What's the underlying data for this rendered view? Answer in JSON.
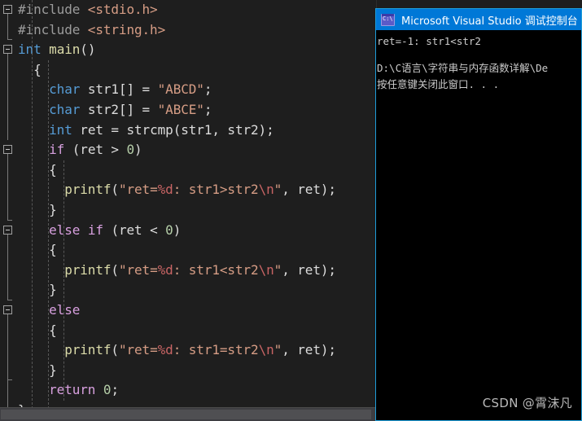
{
  "editor": {
    "name": "visual-studio-code-editor",
    "background_color": "#1e1e1e",
    "code_lines": [
      {
        "indent": 0,
        "fold": "minus",
        "tokens": [
          {
            "t": "#include ",
            "c": "c-pre"
          },
          {
            "t": "<stdio.h>",
            "c": "c-hdr"
          }
        ]
      },
      {
        "indent": 0,
        "fold": "bar-end",
        "tokens": [
          {
            "t": "#include ",
            "c": "c-pre"
          },
          {
            "t": "<string.h>",
            "c": "c-hdr"
          }
        ]
      },
      {
        "indent": 0,
        "fold": "minus",
        "tokens": [
          {
            "t": "int",
            "c": "c-kw"
          },
          {
            "t": " ",
            "c": "c-punc"
          },
          {
            "t": "main",
            "c": "c-fn"
          },
          {
            "t": "()",
            "c": "c-punc"
          }
        ]
      },
      {
        "indent": 1,
        "fold": "bar",
        "tokens": [
          {
            "t": "{",
            "c": "c-br"
          }
        ]
      },
      {
        "indent": 2,
        "fold": "bar",
        "tokens": [
          {
            "t": "char",
            "c": "c-kw"
          },
          {
            "t": " str1[] = ",
            "c": "c-id"
          },
          {
            "t": "\"ABCD\"",
            "c": "c-str"
          },
          {
            "t": ";",
            "c": "c-punc"
          }
        ]
      },
      {
        "indent": 2,
        "fold": "bar",
        "tokens": [
          {
            "t": "char",
            "c": "c-kw"
          },
          {
            "t": " str2[] = ",
            "c": "c-id"
          },
          {
            "t": "\"ABCE\"",
            "c": "c-str"
          },
          {
            "t": ";",
            "c": "c-punc"
          }
        ]
      },
      {
        "indent": 2,
        "fold": "bar",
        "tokens": [
          {
            "t": "int",
            "c": "c-kw"
          },
          {
            "t": " ret = ",
            "c": "c-id"
          },
          {
            "t": "strcmp",
            "c": "c-id"
          },
          {
            "t": "(str1, str2);",
            "c": "c-punc"
          }
        ]
      },
      {
        "indent": 2,
        "fold": "minus",
        "tokens": [
          {
            "t": "if",
            "c": "c-ctrl"
          },
          {
            "t": " (ret > ",
            "c": "c-id"
          },
          {
            "t": "0",
            "c": "c-num"
          },
          {
            "t": ")",
            "c": "c-punc"
          }
        ]
      },
      {
        "indent": 2,
        "fold": "bar",
        "tokens": [
          {
            "t": "{",
            "c": "c-br"
          }
        ]
      },
      {
        "indent": 3,
        "fold": "bar",
        "tokens": [
          {
            "t": "printf",
            "c": "c-fn"
          },
          {
            "t": "(",
            "c": "c-punc"
          },
          {
            "t": "\"ret=",
            "c": "c-str"
          },
          {
            "t": "%d",
            "c": "c-esc"
          },
          {
            "t": ": str1>str2",
            "c": "c-str"
          },
          {
            "t": "\\n",
            "c": "c-esc"
          },
          {
            "t": "\"",
            "c": "c-str"
          },
          {
            "t": ", ret);",
            "c": "c-punc"
          }
        ]
      },
      {
        "indent": 2,
        "fold": "bar-end",
        "tokens": [
          {
            "t": "}",
            "c": "c-br"
          }
        ]
      },
      {
        "indent": 2,
        "fold": "minus",
        "tokens": [
          {
            "t": "else",
            "c": "c-ctrl"
          },
          {
            "t": " ",
            "c": "c-punc"
          },
          {
            "t": "if",
            "c": "c-ctrl"
          },
          {
            "t": " (ret < ",
            "c": "c-id"
          },
          {
            "t": "0",
            "c": "c-num"
          },
          {
            "t": ")",
            "c": "c-punc"
          }
        ]
      },
      {
        "indent": 2,
        "fold": "bar",
        "tokens": [
          {
            "t": "{",
            "c": "c-br"
          }
        ]
      },
      {
        "indent": 3,
        "fold": "bar",
        "tokens": [
          {
            "t": "printf",
            "c": "c-fn"
          },
          {
            "t": "(",
            "c": "c-punc"
          },
          {
            "t": "\"ret=",
            "c": "c-str"
          },
          {
            "t": "%d",
            "c": "c-esc"
          },
          {
            "t": ": str1<str2",
            "c": "c-str"
          },
          {
            "t": "\\n",
            "c": "c-esc"
          },
          {
            "t": "\"",
            "c": "c-str"
          },
          {
            "t": ", ret);",
            "c": "c-punc"
          }
        ]
      },
      {
        "indent": 2,
        "fold": "bar-end",
        "tokens": [
          {
            "t": "}",
            "c": "c-br"
          }
        ]
      },
      {
        "indent": 2,
        "fold": "minus",
        "tokens": [
          {
            "t": "else",
            "c": "c-ctrl"
          }
        ]
      },
      {
        "indent": 2,
        "fold": "bar",
        "tokens": [
          {
            "t": "{",
            "c": "c-br"
          }
        ]
      },
      {
        "indent": 3,
        "fold": "bar",
        "tokens": [
          {
            "t": "printf",
            "c": "c-fn"
          },
          {
            "t": "(",
            "c": "c-punc"
          },
          {
            "t": "\"ret=",
            "c": "c-str"
          },
          {
            "t": "%d",
            "c": "c-esc"
          },
          {
            "t": ": str1=str2",
            "c": "c-str"
          },
          {
            "t": "\\n",
            "c": "c-esc"
          },
          {
            "t": "\"",
            "c": "c-str"
          },
          {
            "t": ", ret);",
            "c": "c-punc"
          }
        ]
      },
      {
        "indent": 2,
        "fold": "bar-end",
        "tokens": [
          {
            "t": "}",
            "c": "c-br"
          }
        ]
      },
      {
        "indent": 2,
        "fold": "bar",
        "tokens": [
          {
            "t": "return",
            "c": "c-ctrl"
          },
          {
            "t": " ",
            "c": "c-punc"
          },
          {
            "t": "0",
            "c": "c-num"
          },
          {
            "t": ";",
            "c": "c-punc"
          }
        ]
      },
      {
        "indent": 0,
        "fold": "bar-end",
        "tokens": [
          {
            "t": "}",
            "c": "c-br"
          }
        ]
      }
    ]
  },
  "console": {
    "title": "Microsoft Visual Studio 调试控制台",
    "icon": "console-cmd-icon",
    "titlebar_color": "#0078d7",
    "lines": [
      "ret=-1: str1<str2",
      "",
      "D:\\C语言\\字符串与内存函数详解\\De",
      "按任意键关闭此窗口. . ."
    ]
  },
  "watermark": {
    "text": "CSDN @霄沫凡"
  }
}
